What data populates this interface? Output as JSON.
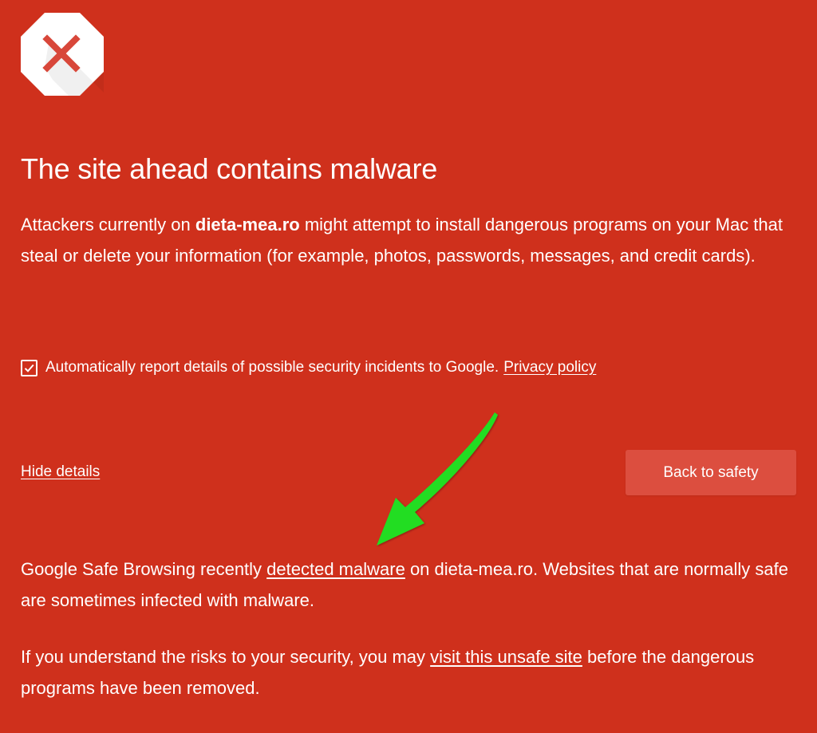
{
  "page": {
    "background_color": "#cf301c",
    "icon": "stop-sign-x-icon"
  },
  "heading": {
    "title": "The site ahead contains malware"
  },
  "intro": {
    "prefix": "Attackers currently on ",
    "site": "dieta-mea.ro",
    "suffix": " might attempt to install dangerous programs on your Mac that steal or delete your information (for example, photos, passwords, messages, and credit cards)."
  },
  "report": {
    "checked": true,
    "label": "Automatically report details of possible security incidents to Google.",
    "privacy_link": "Privacy policy"
  },
  "actions": {
    "hide_details": "Hide details",
    "back_to_safety": "Back to safety",
    "button_color": "#dc4e3f"
  },
  "details": {
    "p1_prefix": "Google Safe Browsing recently ",
    "p1_link": "detected malware",
    "p1_suffix": " on dieta-mea.ro. Websites that are normally safe are sometimes infected with malware.",
    "p2_prefix": "If you understand the risks to your security, you may ",
    "p2_link": "visit this unsafe site",
    "p2_suffix": " before the dangerous programs have been removed."
  },
  "annotation": {
    "arrow_color": "#22dd22",
    "icon": "green-arrow-icon"
  }
}
